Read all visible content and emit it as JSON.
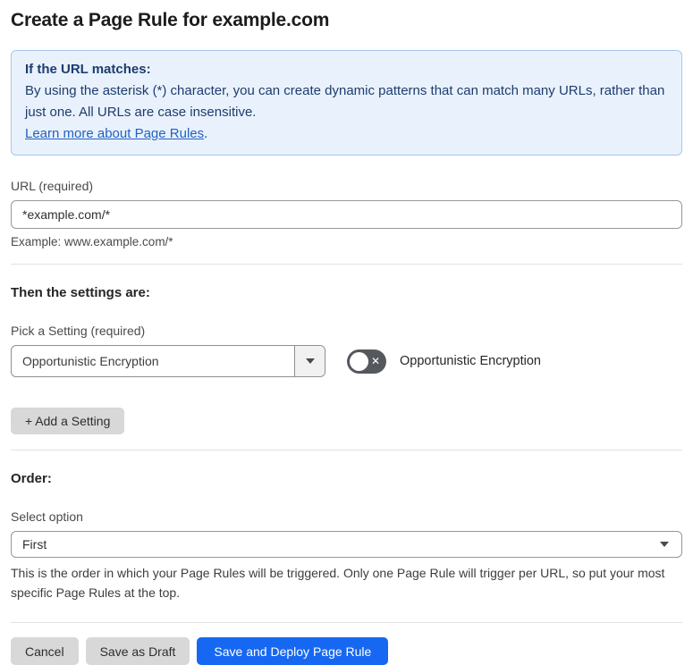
{
  "page": {
    "title": "Create a Page Rule for example.com"
  },
  "info_box": {
    "heading": "If the URL matches:",
    "body": "By using the asterisk (*) character, you can create dynamic patterns that can match many URLs, rather than just one. All URLs are case insensitive.",
    "link_label": "Learn more about Page Rules",
    "link_suffix": "."
  },
  "url_field": {
    "label": "URL (required)",
    "value": "*example.com/*",
    "helper": "Example: www.example.com/*"
  },
  "settings_section": {
    "heading": "Then the settings are:",
    "picker_label": "Pick a Setting (required)",
    "picker_value": "Opportunistic Encryption",
    "toggle_state": "off",
    "toggle_glyph": "✕",
    "toggle_label": "Opportunistic Encryption",
    "add_button_label": "+ Add a Setting"
  },
  "order_section": {
    "heading": "Order:",
    "select_label": "Select option",
    "select_value": "First",
    "helper": "This is the order in which your Page Rules will be triggered. Only one Page Rule will trigger per URL, so put your most specific Page Rules at the top."
  },
  "actions": {
    "cancel_label": "Cancel",
    "save_draft_label": "Save as Draft",
    "save_deploy_label": "Save and Deploy Page Rule"
  },
  "colors": {
    "info_background": "#e9f2fc",
    "info_border": "#a6c8ec",
    "info_text": "#1d3c6e",
    "link_blue": "#2260c4",
    "primary_blue": "#1668f2",
    "button_gray": "#d8d8d8",
    "toggle_off_background": "#55585d"
  }
}
